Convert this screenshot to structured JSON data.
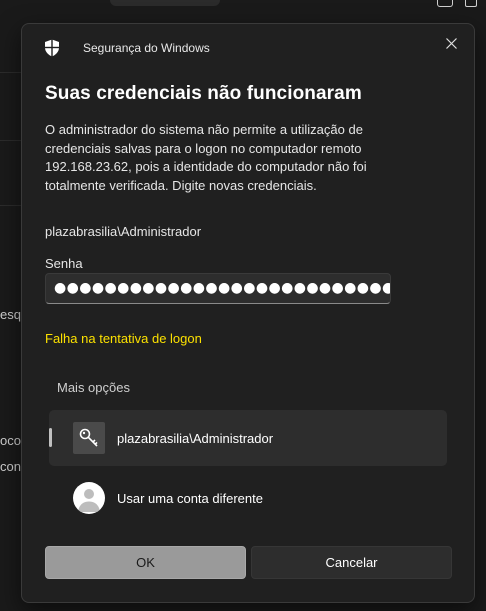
{
  "background": {
    "side_text_1": "esq",
    "side_text_2": "oco",
    "side_text_3": "con"
  },
  "dialog": {
    "app_title": "Segurança do Windows",
    "heading": "Suas credenciais não funcionaram",
    "description": "O administrador do sistema não permite a utilização de credenciais salvas para o logon no computador remoto 192.168.23.62, pois a identidade do computador não foi totalmente verificada. Digite novas credenciais.",
    "username": "plazabrasilia\\Administrador",
    "password_label": "Senha",
    "password_value": "●●●●●●●●●●●●●●●●●●●●●●●●●●●●",
    "error_text": "Falha na tentativa de logon",
    "more_options_label": "Mais opções",
    "accounts": [
      {
        "label": "plazabrasilia\\Administrador",
        "icon": "key-icon",
        "selected": true
      },
      {
        "label": "Usar uma conta diferente",
        "icon": "person-icon",
        "selected": false
      }
    ],
    "ok_label": "OK",
    "cancel_label": "Cancelar"
  },
  "colors": {
    "error": "#fce100",
    "dialog_bg": "#202020",
    "ok_bg": "#9a9a9a"
  }
}
